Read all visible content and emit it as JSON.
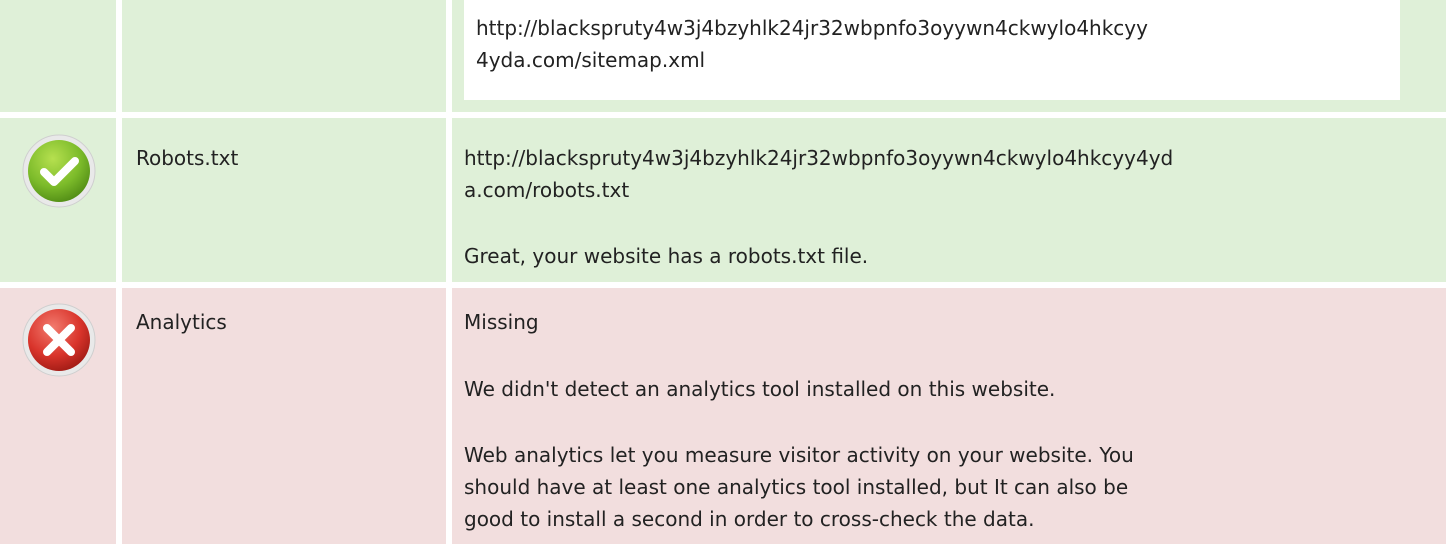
{
  "rows": [
    {
      "status": "success",
      "label": "",
      "value_lines": [
        "http://blackspruty4w3j4bzyhlk24jr32wbpnfo3oyywn4ckwylo4hkcyy",
        "4yda.com/sitemap.xml"
      ]
    },
    {
      "status": "success",
      "icon": "checkmark-circle-icon",
      "label": "Robots.txt",
      "value_lines": [
        "http://blackspruty4w3j4bzyhlk24jr32wbpnfo3oyywn4ckwylo4hkcyy4yd",
        "a.com/robots.txt"
      ],
      "message": "Great, your website has a robots.txt file."
    },
    {
      "status": "error",
      "icon": "error-x-circle-icon",
      "label": "Analytics",
      "value": "Missing",
      "message": "We didn't detect an analytics tool installed on this website.",
      "details_lines": [
        "Web analytics let you measure visitor activity on your website. You",
        "should have at least one analytics tool installed, but It can also be",
        "good to install a second in order to cross-check the data."
      ]
    }
  ],
  "colors": {
    "success_bg": "#dff0d8",
    "error_bg": "#f2dede",
    "check_green": "#7cbb2a",
    "error_red": "#d9342b"
  }
}
